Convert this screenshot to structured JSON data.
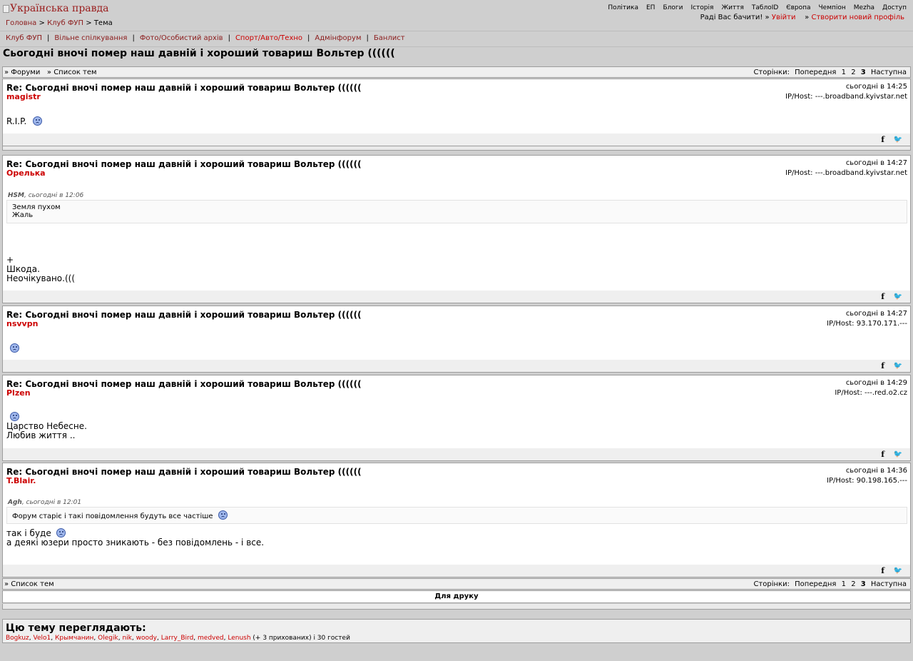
{
  "site": {
    "logo_alt": "Українська правда"
  },
  "topnav": [
    "Політика",
    "ЕП",
    "Блоги",
    "Історія",
    "Життя",
    "ТаблоID",
    "Європа",
    "Чемпіон",
    "Mezha",
    "Доступ"
  ],
  "breadcrumb": {
    "home": "Головна",
    "sep1": ">",
    "club": "Клуб ФУП",
    "sep2": ">",
    "current": "Тема"
  },
  "greeting": {
    "text": "Раді Вас бачити! »",
    "login": "Увійти",
    "arrow": "»",
    "register": "Створити новий профіль"
  },
  "forum_nav": [
    "Клуб ФУП",
    "Вільне спілкування",
    "Фото/Особистий архів",
    "Спорт/Авто/Техно",
    "Адмінфорум",
    "Банлист"
  ],
  "forum_nav_sep": "|",
  "topic_title": "Сьогодні вночі помер наш давній і хороший товариш Вольтер ((((((",
  "top_bar": {
    "forums": "» Форуми",
    "topics": "» Список тем"
  },
  "bottom_bar": {
    "topics": "» Список тем"
  },
  "pager": {
    "label": "Сторінки:",
    "prev": "Попередня",
    "pages": [
      "1",
      "2",
      "3"
    ],
    "current": "3",
    "next": "Наступна"
  },
  "posts": [
    {
      "subject": "Re: Сьогодні вночі помер наш давній і хороший товариш Вольтер ((((((",
      "author": "magistr",
      "time": "сьогодні в 14:25",
      "host": "IP/Host: ---.broadband.kyivstar.net",
      "lines": [
        "R.I.P."
      ]
    },
    {
      "subject": "Re: Сьогодні вночі помер наш давній і хороший товариш Вольтер ((((((",
      "author": "Орелька",
      "time": "сьогодні в 14:27",
      "host": "IP/Host: ---.broadband.kyivstar.net",
      "quote": {
        "author": "HSM",
        "time": ", сьогодні в 12:06",
        "lines": [
          "Земля пухом",
          "Жаль"
        ]
      },
      "lines": [
        "+",
        "Шкода.",
        "Неочікувано.((("
      ]
    },
    {
      "subject": "Re: Сьогодні вночі помер наш давній і хороший товариш Вольтер ((((((",
      "author": "nsvvpn",
      "time": "сьогодні в 14:27",
      "host": "IP/Host: 93.170.171.---",
      "lines": []
    },
    {
      "subject": "Re: Сьогодні вночі помер наш давній і хороший товариш Вольтер ((((((",
      "author": "Plzen",
      "time": "сьогодні в 14:29",
      "host": "IP/Host: ---.red.o2.cz",
      "lines": [
        "Царство Небесне.",
        "Любив життя .."
      ]
    },
    {
      "subject": "Re: Сьогодні вночі помер наш давній і хороший товариш Вольтер ((((((",
      "author": "T.Blair.",
      "time": "сьогодні в 14:36",
      "host": "IP/Host: 90.198.165.---",
      "quote": {
        "author": "Agh",
        "time": ", сьогодні в 12:01",
        "lines": [
          "Форум старіє і такі повідомлення будуть все частіше"
        ]
      },
      "lines": [
        "так і буде",
        "а деякі юзери просто зникають - без повідомлень - і все."
      ]
    }
  ],
  "share": {
    "facebook": "f",
    "twitter": "🐦"
  },
  "print_label": "Для друку",
  "viewers": {
    "title": "Цю тему переглядають:",
    "users": [
      "Bogkuz",
      "Velo1",
      "Крымчанин",
      "Olegik",
      "nik",
      "woody",
      "Larry_Bird",
      "medved",
      "Lenush"
    ],
    "tail": " (+ 3 прихованих) і 30 гостей"
  },
  "icons": {
    "sad": "sad-smiley-icon"
  },
  "colors": {
    "background": "#cfcfcf",
    "link_red": "#cc0000",
    "link_dark": "#8b1a1a"
  }
}
